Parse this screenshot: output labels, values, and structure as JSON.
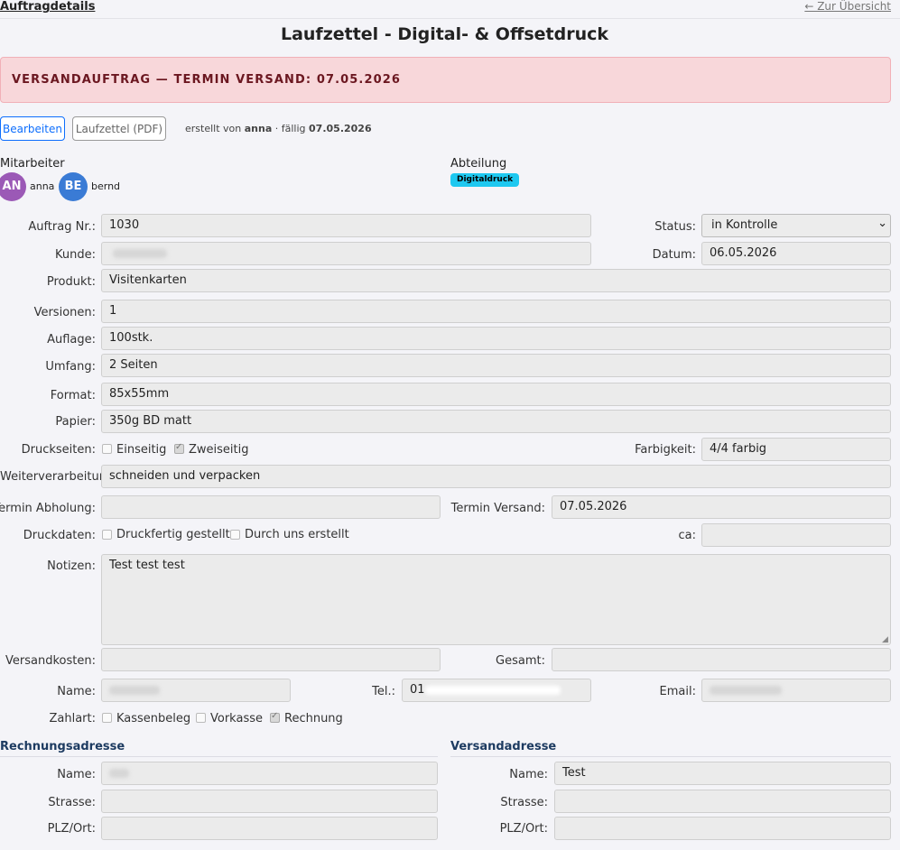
{
  "header": {
    "section_link": "Auftragdetails",
    "back_link": "← Zur Übersicht",
    "title": "Laufzettel - Digital- & Offsetdruck"
  },
  "alert": {
    "text": "VERSANDAUFTRAG — TERMIN VERSAND: 07.05.2026"
  },
  "toolbar": {
    "edit_label": "Bearbeiten",
    "pdf_label": "Laufzettel (PDF)",
    "meta_created_prefix": "erstellt von",
    "meta_created_by": "anna",
    "meta_due_prefix": "· fällig",
    "meta_due_date": "07.05.2026"
  },
  "staff": {
    "label": "Mitarbeiter",
    "members": [
      {
        "initials": "AN",
        "name": "anna",
        "color": "#9b59b6"
      },
      {
        "initials": "BE",
        "name": "bernd",
        "color": "#3a7bd5"
      }
    ]
  },
  "department": {
    "label": "Abteilung",
    "badge": "Digitaldruck",
    "badge_color": "#1ec8f0"
  },
  "form": {
    "auftrag_label": "Auftrag Nr.:",
    "auftrag_value": "1030",
    "status_label": "Status:",
    "status_value": "in Kontrolle",
    "kunde_label": "Kunde:",
    "datum_label": "Datum:",
    "datum_value": "06.05.2026",
    "produkt_label": "Produkt:",
    "produkt_value": "Visitenkarten",
    "versionen_label": "Versionen:",
    "versionen_value": "1",
    "auflage_label": "Auflage:",
    "auflage_value": "100stk.",
    "umfang_label": "Umfang:",
    "umfang_value": "2 Seiten",
    "format_label": "Format:",
    "format_value": "85x55mm",
    "papier_label": "Papier:",
    "papier_value": "350g BD matt",
    "druckseiten_label": "Druckseiten:",
    "einseitig_label": "Einseitig",
    "einseitig_checked": false,
    "zweiseitig_label": "Zweiseitig",
    "zweiseitig_checked": true,
    "farbigkeit_label": "Farbigkeit:",
    "farbigkeit_value": "4/4 farbig",
    "weiterverarbeitung_label": "Weiterverarbeitung:",
    "weiterverarbeitung_value": "schneiden und verpacken",
    "termin_abholung_label": "Termin Abholung:",
    "termin_abholung_value": "",
    "termin_versand_label": "Termin Versand:",
    "termin_versand_value": "07.05.2026",
    "druckdaten_label": "Druckdaten:",
    "druckfertig_label": "Druckfertig gestellt",
    "druckfertig_checked": false,
    "durch_uns_label": "Durch uns erstellt",
    "durch_uns_checked": false,
    "ca_label": "ca:",
    "ca_value": "",
    "notizen_label": "Notizen:",
    "notizen_value": "Test test test",
    "versandkosten_label": "Versandkosten:",
    "versandkosten_value": "",
    "gesamt_label": "Gesamt:",
    "gesamt_value": "",
    "name_label": "Name:",
    "tel_label": "Tel.:",
    "tel_value": "01",
    "email_label": "Email:",
    "zahlart_label": "Zahlart:",
    "kassenbeleg_label": "Kassenbeleg",
    "kassenbeleg_checked": false,
    "vorkasse_label": "Vorkasse",
    "vorkasse_checked": false,
    "rechnung_label": "Rechnung",
    "rechnung_checked": true
  },
  "billing": {
    "heading": "Rechnungsadresse",
    "name_label": "Name:",
    "strasse_label": "Strasse:",
    "plz_label": "PLZ/Ort:",
    "strasse_value": "",
    "plz_value": ""
  },
  "shipping": {
    "heading": "Versandadresse",
    "name_label": "Name:",
    "name_value": "Test",
    "strasse_label": "Strasse:",
    "strasse_value": "",
    "plz_label": "PLZ/Ort:",
    "plz_value": ""
  }
}
